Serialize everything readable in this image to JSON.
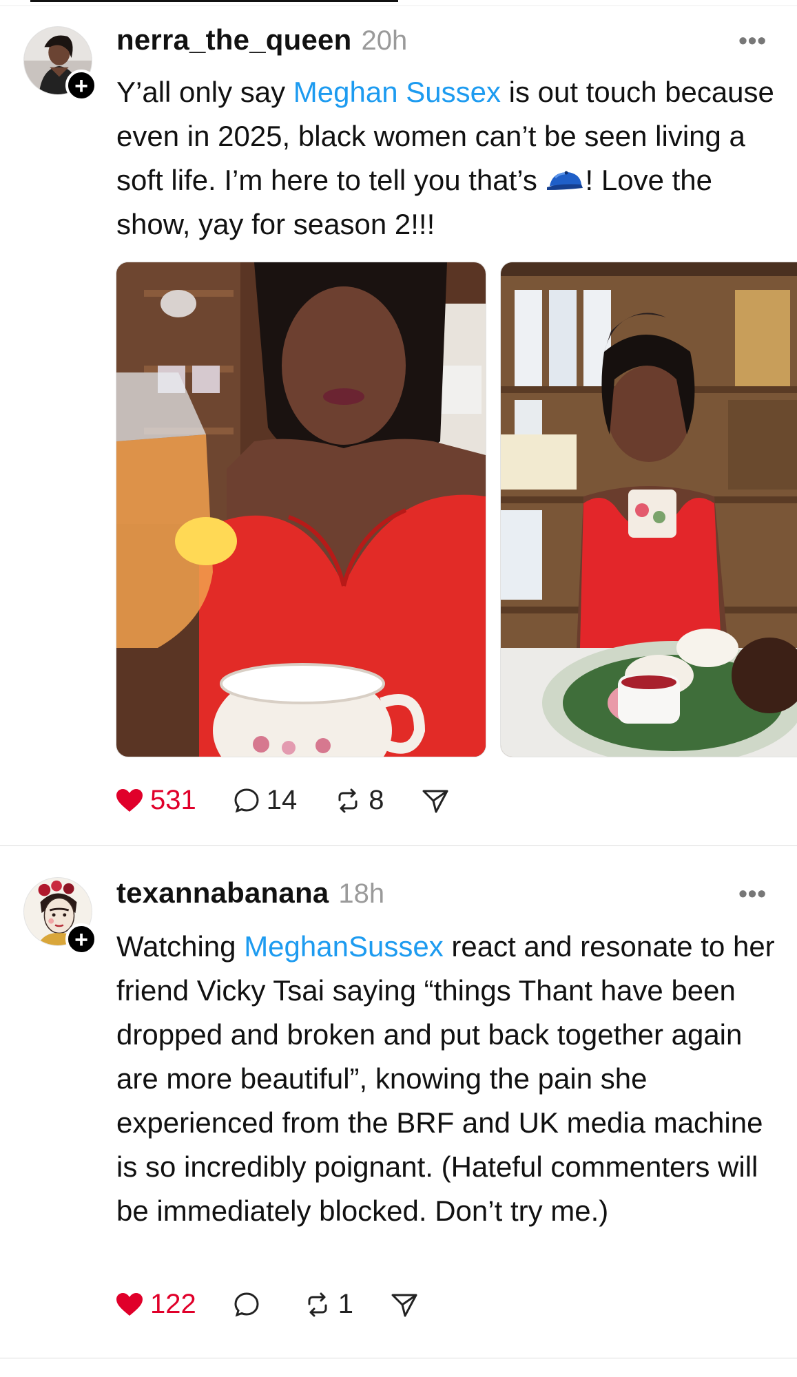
{
  "posts": [
    {
      "username": "nerra_the_queen",
      "time": "20h",
      "more_label": "•••",
      "text_parts": {
        "before_mention": "Y’all only say ",
        "mention": "Meghan Sussex",
        "after_mention": " is out touch because even in 2025, black women can’t be seen living a soft life. I’m here to tell you that’s ",
        "after_emoji": "! Love the show, yay for season 2!!!"
      },
      "emoji_icon": "blue-cap-icon",
      "images": [
        "photo-tea-pour",
        "photo-tea-cup-shelves"
      ],
      "likes": "531",
      "comments": "14",
      "reposts": "8"
    },
    {
      "username": "texannabanana",
      "time": "18h",
      "more_label": "•••",
      "text_parts": {
        "before_mention": "Watching ",
        "mention": "MeghanSussex",
        "after_mention": " react and resonate to her friend Vicky Tsai saying “things Thant have been dropped and broken and put back together again are more beautiful”, knowing the pain she experienced from the BRF and UK media machine is so incredibly poignant. (Hateful commenters will be immediately blocked. Don’t try me.)"
      },
      "likes": "122",
      "comments": "",
      "reposts": "1"
    }
  ],
  "colors": {
    "like": "#e0002a",
    "mention": "#1d9bf0",
    "muted": "#9a9a9a"
  }
}
